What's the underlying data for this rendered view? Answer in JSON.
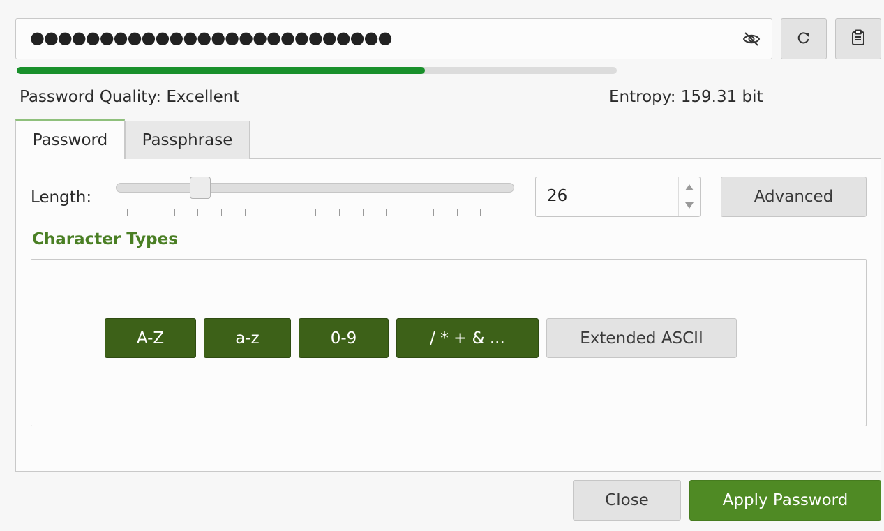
{
  "password": {
    "masked_value": "●●●●●●●●●●●●●●●●●●●●●●●●●●",
    "visibility_icon": "eye-slash-icon",
    "regenerate_icon": "refresh-icon",
    "copy_icon": "clipboard-icon"
  },
  "quality": {
    "label": "Password Quality: Excellent",
    "entropy": "Entropy: 159.31 bit",
    "meter_fraction": 0.68,
    "meter_color": "#19902b"
  },
  "tabs": [
    {
      "label": "Password",
      "active": true
    },
    {
      "label": "Passphrase",
      "active": false
    }
  ],
  "length": {
    "label": "Length:",
    "value": "26",
    "advanced_label": "Advanced"
  },
  "character_types": {
    "title": "Character Types",
    "buttons": [
      {
        "label": "A-Z",
        "checked": true
      },
      {
        "label": "a-z",
        "checked": true
      },
      {
        "label": "0-9",
        "checked": true
      },
      {
        "label": "/ * + & ...",
        "checked": true
      },
      {
        "label": "Extended ASCII",
        "checked": false
      }
    ]
  },
  "footer": {
    "close_label": "Close",
    "apply_label": "Apply Password"
  },
  "colors": {
    "accent_green": "#4f8a24",
    "checked_green": "#3d6118",
    "title_green": "#4a7f24"
  }
}
